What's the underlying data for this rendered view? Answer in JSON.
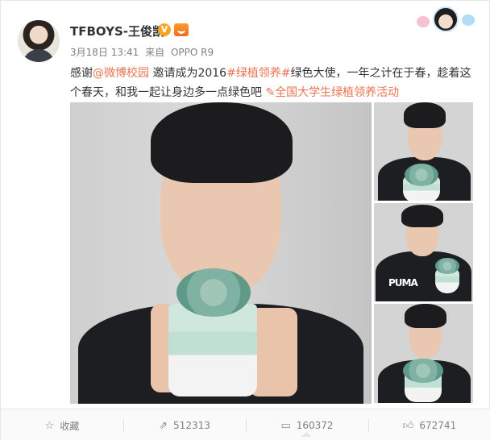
{
  "post": {
    "author": "TFBOYS-王俊凯",
    "verified_badge": "V",
    "date": "3月18日 13:41",
    "via_label": "来自",
    "device": "OPPO R9",
    "text": {
      "part1": "感谢",
      "mention": "@微博校园",
      "part2": " 邀请成为2016",
      "topic": "#绿植领养#",
      "part3": "绿色大使，一年之计在于春，趁着这个春天，和我一起让身边多一点绿色吧 ",
      "link_icon": "✎",
      "link_label": "全国大学生绿植领养活动"
    },
    "photo_logo": "PUMA"
  },
  "footer": {
    "favorite": {
      "icon": "star-icon",
      "label": "收藏"
    },
    "repost": {
      "icon": "repost-icon",
      "count": "512313"
    },
    "comment": {
      "icon": "comment-icon",
      "count": "160372"
    },
    "like": {
      "icon": "thumb-up-icon",
      "count": "672741"
    }
  },
  "colors": {
    "link": "#eb7350",
    "meta": "#808080",
    "badge": "#f5a623"
  }
}
